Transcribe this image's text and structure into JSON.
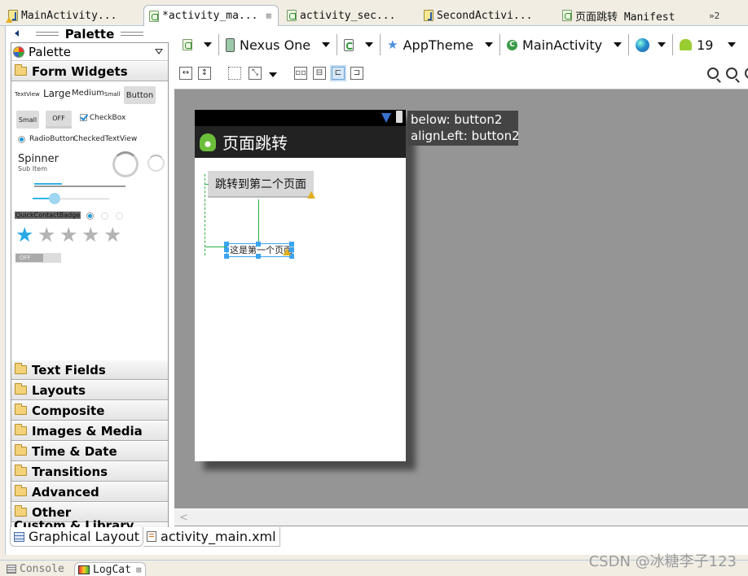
{
  "editor_tabs": [
    {
      "label": "MainActivity...",
      "icon": "java-file-warning-icon",
      "active": false
    },
    {
      "label": "*activity_ma...",
      "icon": "xml-layout-icon",
      "active": true,
      "closable": true
    },
    {
      "label": "activity_sec...",
      "icon": "xml-layout-icon",
      "active": false
    },
    {
      "label": "SecondActivi...",
      "icon": "java-file-icon",
      "active": false
    },
    {
      "label": "页面跳转 Manifest",
      "icon": "xml-layout-icon",
      "active": false
    }
  ],
  "editor_tabs_overflow": "»2",
  "palette": {
    "title": "Palette",
    "selector_value": "Palette",
    "open_category": "Form Widgets",
    "widgets": {
      "textview": "TextView",
      "large": "Large",
      "medium": "Medium",
      "small": "Small",
      "button": "Button",
      "small_button": "Small",
      "toggle": "OFF",
      "checkbox": "CheckBox",
      "radio": "RadioButton",
      "checked_textview": "CheckedTextView",
      "spinner": "Spinner",
      "spinner_sub": "Sub Item",
      "quick_contact": "QuickContactBadge",
      "switch": "OFF",
      "rating_value": 1,
      "rating_max": 5
    },
    "categories": [
      "Text Fields",
      "Layouts",
      "Composite",
      "Images & Media",
      "Time & Date",
      "Transitions",
      "Advanced",
      "Other"
    ],
    "custom_category": "Custom & Library Views"
  },
  "toolbar": {
    "device": "Nexus One",
    "theme": "AppTheme",
    "activity": "MainActivity",
    "api_level": "19"
  },
  "device_preview": {
    "app_title": "页面跳转",
    "button_text": "跳转到第二个页面",
    "textview_text": "这是第一个页面"
  },
  "tooltip": {
    "line1": "below: button2",
    "line2": "alignLeft: button2"
  },
  "bottom_tabs": [
    {
      "label": "Graphical Layout",
      "active": true
    },
    {
      "label": "activity_main.xml",
      "active": false
    }
  ],
  "view_tabs": [
    {
      "label": "Console",
      "active": false
    },
    {
      "label": "LogCat",
      "active": true
    }
  ],
  "watermark": "CSDN @冰糖李子123"
}
